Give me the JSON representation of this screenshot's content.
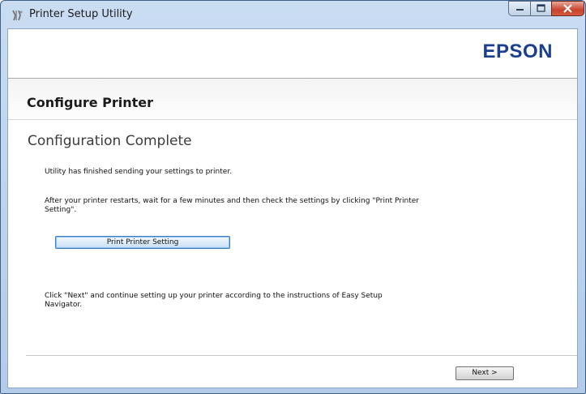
{
  "window": {
    "title": "Printer Setup Utility"
  },
  "header": {
    "logo": "EPSON"
  },
  "main": {
    "heading": "Configure Printer",
    "subheading": "Configuration Complete",
    "text1": "Utility has finished sending your settings to printer.",
    "text2": "After your printer restarts, wait for a few minutes and then check the settings by clicking \"Print Printer Setting\".",
    "print_button": "Print Printer Setting",
    "text3": "Click \"Next\" and continue setting up your printer according to the instructions of Easy Setup Navigator."
  },
  "footer": {
    "next_button": "Next >"
  },
  "icons": {
    "app": "printer-tools-icon",
    "minimize": "minimize-icon",
    "maximize": "maximize-icon",
    "close": "close-icon"
  },
  "colors": {
    "brand": "#1b3f8f",
    "titlebar": "#c9dcf2",
    "close": "#c7432c"
  }
}
